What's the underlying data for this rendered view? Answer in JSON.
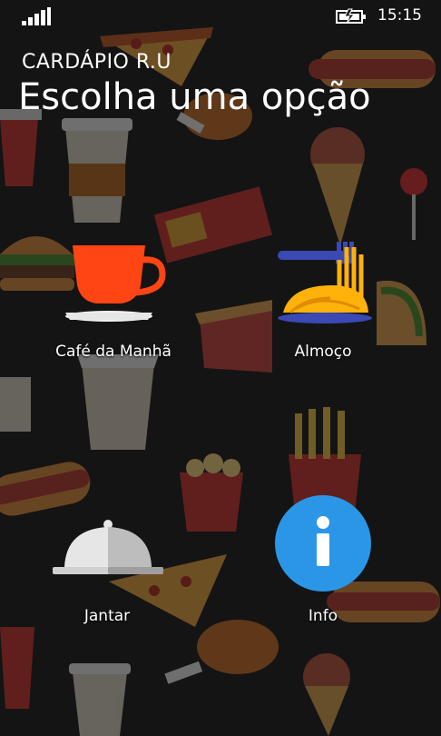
{
  "status_bar": {
    "time": "15:15",
    "signal_icon": "signal-bars-icon",
    "battery_icon": "battery-charging-icon"
  },
  "header": {
    "app_title": "CARDÁPIO R.U",
    "page_title": "Escolha uma opção"
  },
  "menu": {
    "breakfast_label": "Café da Manhã",
    "lunch_label": "Almoço",
    "dinner_label": "Jantar",
    "info_label": "Info"
  },
  "colors": {
    "background": "#141414",
    "cup": "#ff4514",
    "pasta": "#ffb20a",
    "fork": "#3a49b4",
    "info": "#2b96e6",
    "cloche": "#e6e6e6"
  },
  "background_icons": [
    "pizza-slice-icon",
    "hot-dog-icon",
    "coffee-cup-icon",
    "burger-icon",
    "fries-icon",
    "ice-cream-icon",
    "chicken-leg-icon",
    "chocolate-bar-icon",
    "pie-slice-icon",
    "soda-cup-icon",
    "lollipop-icon",
    "noodle-box-icon",
    "taco-icon",
    "popcorn-icon"
  ]
}
